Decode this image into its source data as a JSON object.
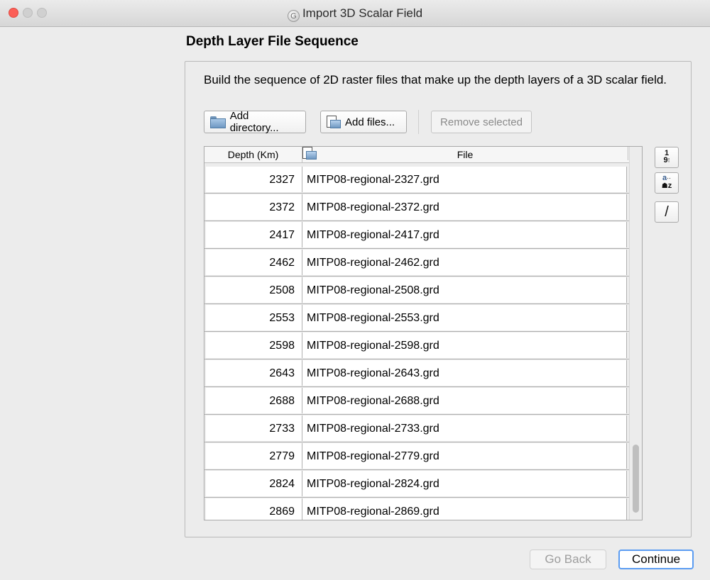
{
  "window": {
    "title": "Import 3D Scalar Field",
    "app_icon": "G"
  },
  "page": {
    "title": "Depth Layer File Sequence",
    "description": "Build the sequence of 2D raster files that make up the depth layers of a 3D scalar field."
  },
  "toolbar": {
    "add_directory_label": "Add directory...",
    "add_files_label": "Add files...",
    "remove_selected_label": "Remove selected"
  },
  "table": {
    "headers": {
      "depth": "Depth (Km)",
      "file": "File"
    },
    "rows": [
      {
        "depth": "2327",
        "file": "MITP08-regional-2327.grd"
      },
      {
        "depth": "2372",
        "file": "MITP08-regional-2372.grd"
      },
      {
        "depth": "2417",
        "file": "MITP08-regional-2417.grd"
      },
      {
        "depth": "2462",
        "file": "MITP08-regional-2462.grd"
      },
      {
        "depth": "2508",
        "file": "MITP08-regional-2508.grd"
      },
      {
        "depth": "2553",
        "file": "MITP08-regional-2553.grd"
      },
      {
        "depth": "2598",
        "file": "MITP08-regional-2598.grd"
      },
      {
        "depth": "2643",
        "file": "MITP08-regional-2643.grd"
      },
      {
        "depth": "2688",
        "file": "MITP08-regional-2688.grd"
      },
      {
        "depth": "2733",
        "file": "MITP08-regional-2733.grd"
      },
      {
        "depth": "2779",
        "file": "MITP08-regional-2779.grd"
      },
      {
        "depth": "2824",
        "file": "MITP08-regional-2824.grd"
      },
      {
        "depth": "2869",
        "file": "MITP08-regional-2869.grd"
      }
    ]
  },
  "side_tools": {
    "sort_numeric_top": "1",
    "sort_numeric_bottom": "9",
    "sort_alpha_top": "a",
    "sort_alpha_bottom": "z",
    "edit_glyph": "/"
  },
  "footer": {
    "go_back_label": "Go Back",
    "continue_label": "Continue"
  },
  "colors": {
    "close_button": "#fc5f57",
    "default_button_border": "#5b9cf2",
    "window_background": "#ececec"
  }
}
